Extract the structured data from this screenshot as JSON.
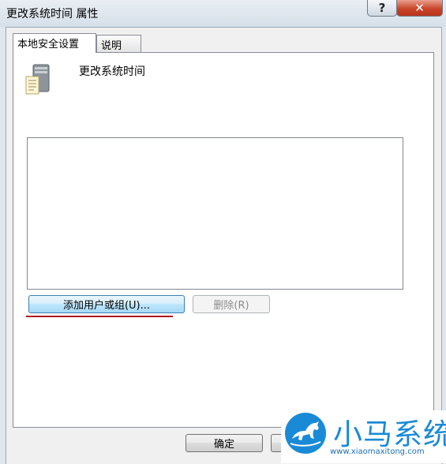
{
  "window": {
    "title": "更改系统时间 属性",
    "help_label": "?",
    "close_label": "✕"
  },
  "tabs": [
    {
      "label": "本地安全设置",
      "active": true
    },
    {
      "label": "说明",
      "active": false
    }
  ],
  "policy": {
    "icon": "server-policy-icon",
    "name": "更改系统时间"
  },
  "members_list": [],
  "buttons": {
    "add": "添加用户或组(U)...",
    "remove": "删除(R)",
    "ok": "确定",
    "cancel": ""
  },
  "watermark": {
    "title": "小马系统",
    "url": "www.xiaomaxitong.com",
    "icon": "horse-logo-icon"
  },
  "colors": {
    "underline": "#b01818",
    "watermark": "#1a8ad6"
  }
}
